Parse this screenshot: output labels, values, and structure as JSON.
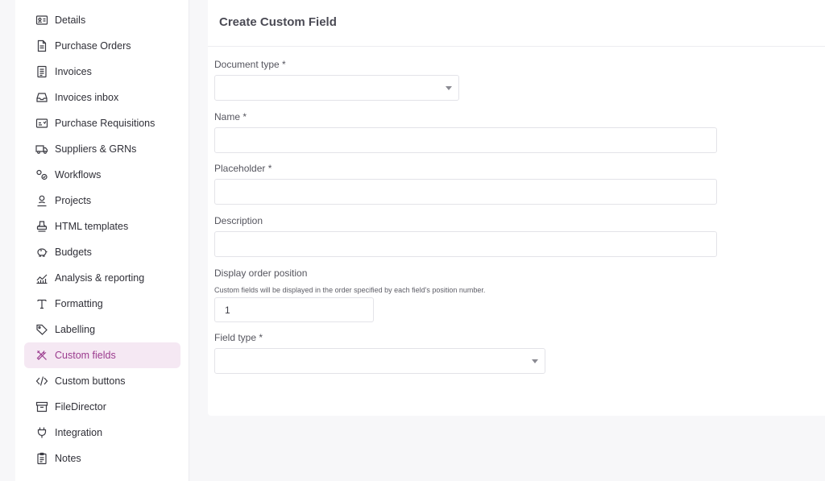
{
  "sidebar": {
    "items": [
      {
        "label": "Details",
        "icon": "id-card-icon"
      },
      {
        "label": "Purchase Orders",
        "icon": "document-icon"
      },
      {
        "label": "Invoices",
        "icon": "receipt-icon"
      },
      {
        "label": "Invoices inbox",
        "icon": "inbox-icon"
      },
      {
        "label": "Purchase Requisitions",
        "icon": "requisition-icon"
      },
      {
        "label": "Suppliers & GRNs",
        "icon": "truck-icon"
      },
      {
        "label": "Workflows",
        "icon": "workflow-icon"
      },
      {
        "label": "Projects",
        "icon": "person-pin-icon"
      },
      {
        "label": "HTML templates",
        "icon": "stamp-icon"
      },
      {
        "label": "Budgets",
        "icon": "piggy-bank-icon"
      },
      {
        "label": "Analysis & reporting",
        "icon": "chart-icon"
      },
      {
        "label": "Formatting",
        "icon": "text-format-icon"
      },
      {
        "label": "Labelling",
        "icon": "tag-icon"
      },
      {
        "label": "Custom fields",
        "icon": "tools-icon"
      },
      {
        "label": "Custom buttons",
        "icon": "code-icon"
      },
      {
        "label": "FileDirector",
        "icon": "archive-icon"
      },
      {
        "label": "Integration",
        "icon": "plug-icon"
      },
      {
        "label": "Notes",
        "icon": "clipboard-icon"
      }
    ],
    "active_index": 13
  },
  "form": {
    "title": "Create Custom Field",
    "document_type_label": "Document type *",
    "document_type_value": "",
    "name_label": "Name  *",
    "name_value": "",
    "placeholder_label": "Placeholder  *",
    "placeholder_value": "",
    "description_label": "Description",
    "description_value": "",
    "display_order_label": "Display order position",
    "display_order_help": "Custom fields will be displayed in the order specified by each field's position number.",
    "display_order_value": "1",
    "field_type_label": "Field type *",
    "field_type_value": ""
  },
  "colors": {
    "accent": "#9b3b8e",
    "active_bg": "#f5e8f3"
  }
}
